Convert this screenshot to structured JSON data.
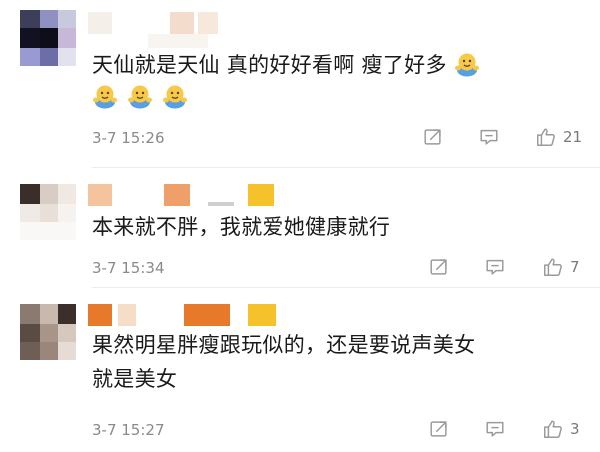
{
  "comments": [
    {
      "text": "天仙就是天仙 真的好好看啊 瘦了好多",
      "emoji_count_inline": 1,
      "emoji_count_row": 3,
      "time": "3-7 15:26",
      "likes": "21"
    },
    {
      "text": "本来就不胖，我就爱她健康就行",
      "time": "3-7 15:34",
      "likes": "7"
    },
    {
      "text_line1": "果然明星胖瘦跟玩似的，还是要说声美女",
      "text_line2": "就是美女",
      "time": "3-7 15:27",
      "likes": "3"
    }
  ],
  "icons": {
    "share": "share-icon",
    "reply": "reply-icon",
    "like": "thumbs-up-icon",
    "emoji": "hugging-emoji-icon"
  },
  "colors": {
    "text": "#1a1a1a",
    "meta": "#8a8a8a",
    "icon": "#9a9a9a",
    "emoji_yellow": "#f7c948",
    "emoji_blue": "#5aa0e0",
    "censor_orange": "#e77a2a",
    "censor_yellow": "#f6c22c"
  }
}
